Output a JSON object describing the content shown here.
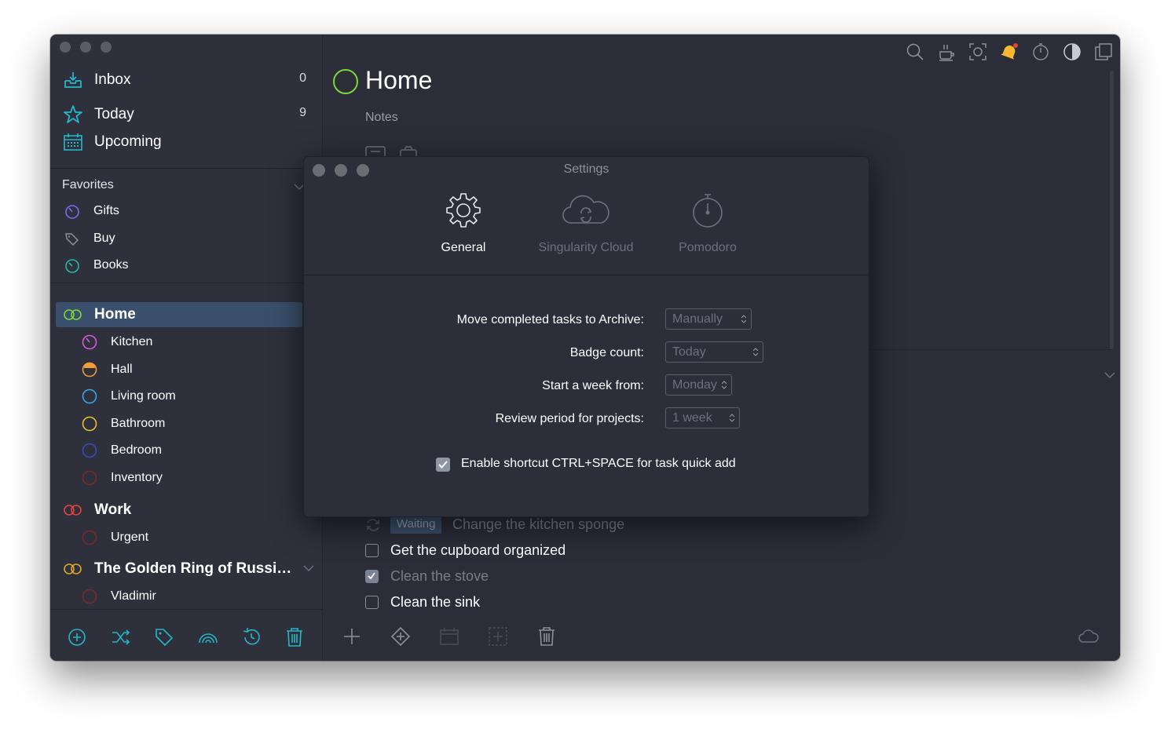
{
  "sidebar": {
    "nav": [
      {
        "label": "Inbox",
        "count": "0"
      },
      {
        "label": "Today",
        "count": "9"
      },
      {
        "label": "Upcoming",
        "count": ""
      }
    ],
    "favorites_label": "Favorites",
    "favorites": [
      {
        "label": "Gifts"
      },
      {
        "label": "Buy"
      },
      {
        "label": "Books"
      }
    ],
    "projects": [
      {
        "label": "Home",
        "selected": true,
        "children": [
          "Kitchen",
          "Hall",
          "Living room",
          "Bathroom",
          "Bedroom",
          "Inventory"
        ]
      },
      {
        "label": "Work",
        "children": [
          "Urgent"
        ]
      },
      {
        "label": "The Golden Ring of Russi…",
        "children": [
          "Vladimir"
        ]
      }
    ]
  },
  "main": {
    "title": "Home",
    "notes_label": "Notes",
    "tasks": [
      {
        "badge": "Waiting",
        "text": "Change the kitchen sponge",
        "checked": false,
        "repeat": true
      },
      {
        "text": "Get the cupboard organized",
        "checked": false
      },
      {
        "text": "Clean the stove",
        "checked": true
      },
      {
        "text": "Clean the sink",
        "checked": false
      }
    ]
  },
  "settings": {
    "title": "Settings",
    "tabs": [
      {
        "label": "General",
        "active": true
      },
      {
        "label": "Singularity Cloud",
        "active": false
      },
      {
        "label": "Pomodoro",
        "active": false
      }
    ],
    "rows": [
      {
        "label": "Move completed tasks to Archive:",
        "value": "Manually"
      },
      {
        "label": "Badge count:",
        "value": "Today"
      },
      {
        "label": "Start a week from:",
        "value": "Monday"
      },
      {
        "label": "Review period for projects:",
        "value": "1 week"
      }
    ],
    "shortcut_label": "Enable shortcut CTRL+SPACE for task quick add",
    "shortcut_checked": true
  },
  "colors": {
    "accent": "#25b6c9",
    "home": "#7dd63a",
    "work": "#e5453a",
    "selection": "#3a4f6b"
  }
}
